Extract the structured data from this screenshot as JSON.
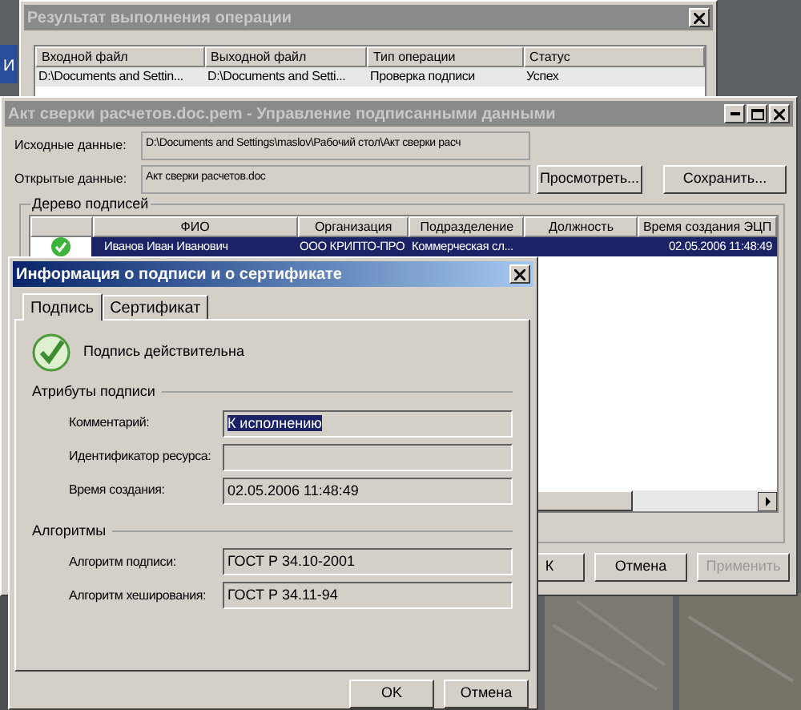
{
  "desktop": {
    "icon_label": "И"
  },
  "result_window": {
    "title": "Результат выполнения операции",
    "active": false,
    "columns": [
      "Входной файл",
      "Выходной файл",
      "Тип операции",
      "Статус"
    ],
    "rows": [
      [
        "D:\\Documents and Settin...",
        "D:\\Documents and Setti...",
        "Проверка подписи",
        "Успех"
      ]
    ]
  },
  "manager_window": {
    "title": "Акт сверки расчетов.doc.pem - Управление подписанными данными",
    "active": false,
    "fields": [
      {
        "label": "Исходные данные:",
        "value": "D:\\Documents and Settings\\maslov\\Рабочий стол\\Акт сверки расч"
      },
      {
        "label": "Открытые данные:",
        "value": "Акт сверки расчетов.doc"
      }
    ],
    "field_buttons": [
      "Просмотреть...",
      "Сохранить..."
    ],
    "group_title": "Дерево подписей",
    "columns": [
      "ФИО",
      "Организация",
      "Подразделение",
      "Должность",
      "Время создания ЭЦП"
    ],
    "rows": [
      {
        "selected": true,
        "valid": true,
        "cells": [
          "Иванов Иван Иванович",
          "ООО КРИПТО-ПРО",
          "Коммерческая сл...",
          "",
          "02.05.2006  11:48:49"
        ]
      }
    ],
    "buttons": [
      {
        "label": "К",
        "disabled": false
      },
      {
        "label": "Отмена",
        "disabled": false
      },
      {
        "label": "Применить",
        "disabled": true
      }
    ]
  },
  "info_dialog": {
    "title": "Информация о подписи и о сертификате",
    "active": true,
    "tabs": [
      {
        "label": "Подпись",
        "selected": true
      },
      {
        "label": "Сертификат",
        "selected": false
      }
    ],
    "status": {
      "valid": true,
      "text": "Подпись действительна"
    },
    "sections": [
      {
        "title": "Атрибуты подписи",
        "fields": [
          {
            "label": "Комментарий:",
            "value": "К исполнению",
            "highlighted": true
          },
          {
            "label": "Идентификатор ресурса:"
          },
          {
            "label": "Время создания:",
            "value": "02.05.2006 11:48:49"
          }
        ]
      },
      {
        "title": "Алгоритмы",
        "fields": [
          {
            "label": "Алгоритм подписи:",
            "value": "ГОСТ Р 34.10-2001"
          },
          {
            "label": "Алгоритм хеширования:",
            "value": "ГОСТ Р 34.11-94"
          }
        ]
      }
    ],
    "buttons": [
      "OK",
      "Отмена"
    ]
  }
}
